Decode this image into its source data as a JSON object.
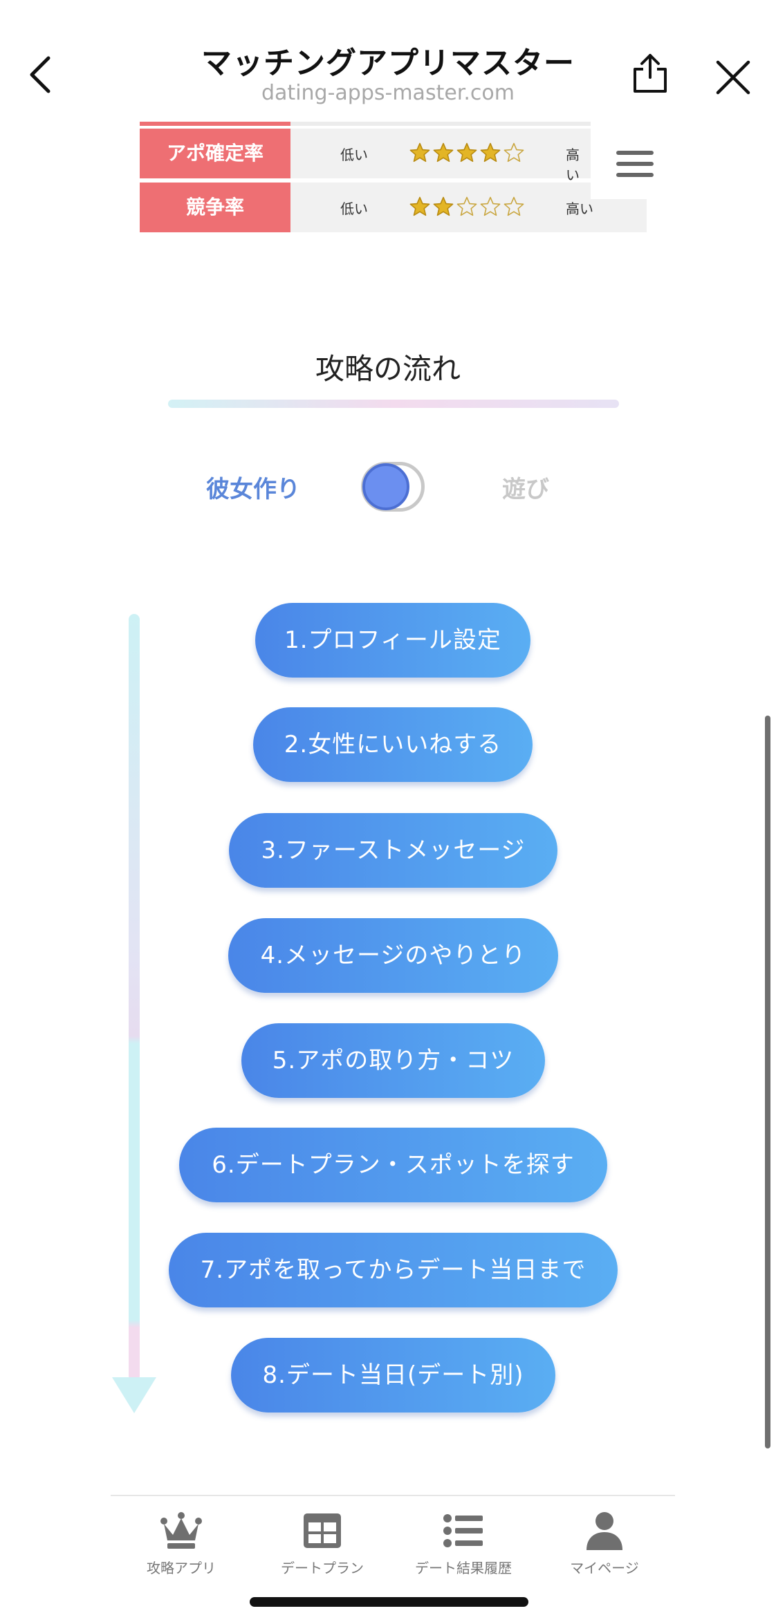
{
  "header": {
    "title": "マッチングアプリマスター",
    "url": "dating-apps-master.com",
    "icons": {
      "back": "chevron-left-icon",
      "share": "share-icon",
      "close": "close-icon"
    }
  },
  "ratings": [
    {
      "label": "アポ確定率",
      "low": "低い",
      "high": "高い",
      "stars_filled": 4,
      "stars_total": 5
    },
    {
      "label": "競争率",
      "low": "低い",
      "high": "高い",
      "stars_filled": 2,
      "stars_total": 5
    }
  ],
  "section": {
    "title": "攻略の流れ"
  },
  "toggle": {
    "left_label": "彼女作り",
    "right_label": "遊び",
    "selected": "left"
  },
  "steps": [
    "1.プロフィール設定",
    "2.女性にいいねする",
    "3.ファーストメッセージ",
    "4.メッセージのやりとり",
    "5.アポの取り方・コツ",
    "6.デートプラン・スポットを探す",
    "7.アポを取ってからデート当日まで",
    "8.デート当日(デート別)"
  ],
  "bottom_nav": [
    {
      "label": "攻略アプリ",
      "icon": "crown-icon"
    },
    {
      "label": "デートプラン",
      "icon": "grid-icon"
    },
    {
      "label": "デート結果履歴",
      "icon": "list-icon"
    },
    {
      "label": "マイページ",
      "icon": "user-icon"
    }
  ],
  "colors": {
    "accent_red": "#ee6f73",
    "toggle_active": "#5a86d9",
    "button_gradient_start": "#4a86e8",
    "button_gradient_end": "#5aaef3",
    "star_gold": "#e3b526"
  }
}
